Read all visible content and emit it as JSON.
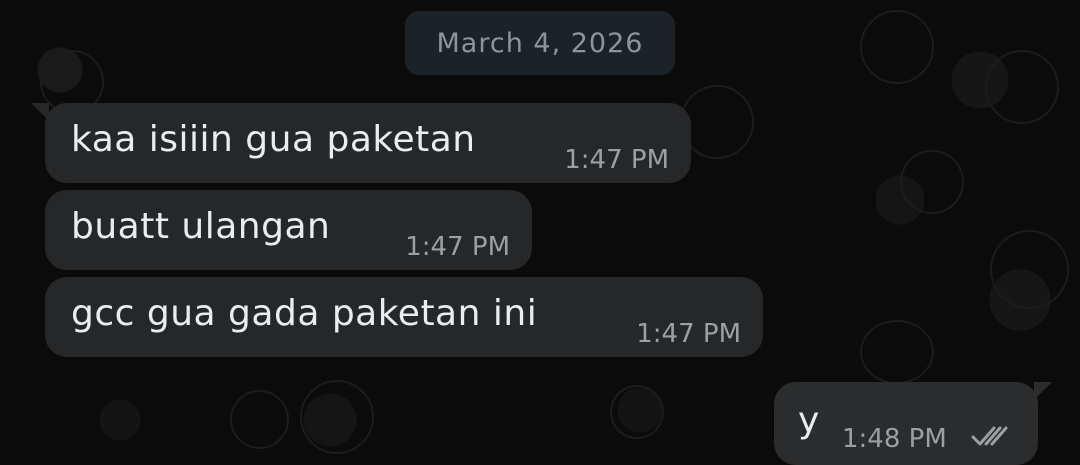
{
  "date_label": "March 4, 2026",
  "messages": [
    {
      "text": "kaa isiiin gua paketan",
      "time": "1:47 PM",
      "direction": "incoming"
    },
    {
      "text": "buatt ulangan",
      "time": "1:47 PM",
      "direction": "incoming"
    },
    {
      "text": "gcc gua gada paketan ini",
      "time": "1:47 PM",
      "direction": "incoming"
    },
    {
      "text": "y",
      "time": "1:48 PM",
      "direction": "outgoing",
      "status_icon": "double-check-icon"
    }
  ],
  "colors": {
    "background": "#0b0b0b",
    "incoming_bubble": "#252729",
    "outgoing_bubble": "#2a2c2e",
    "date_chip": "#1c2328",
    "timestamp": "#9aa0a3"
  }
}
